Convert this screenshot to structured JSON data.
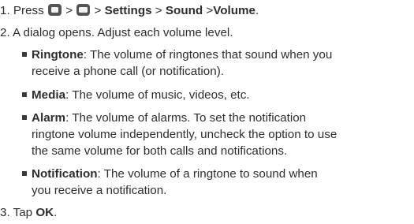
{
  "steps": {
    "s1": {
      "num": "1. Press",
      "sep1": ">",
      "sep2": ">",
      "settings": "Settings",
      "sep3": ">",
      "sound": "Sound",
      "sep4": ">",
      "volume": "Volume",
      "end": ".",
      "icon1": "home-key-icon",
      "icon2": "menu-key-icon"
    },
    "s2": "2. A dialog opens. Adjust each volume level.",
    "s3": {
      "num": "3. Tap",
      "ok": "OK",
      "end": "."
    }
  },
  "bullets": [
    {
      "term": "Ringtone",
      "lines": [
        ": The volume of ringtones that sound when you",
        "receive a phone call (or notification)."
      ]
    },
    {
      "term": "Media",
      "lines": [
        ": The volume of music, videos, etc."
      ]
    },
    {
      "term": "Alarm",
      "lines": [
        ": The volume of alarms. To set the notification",
        "ringtone volume independently, uncheck the option to use",
        "the same volume for both calls and notifications."
      ]
    },
    {
      "term": "Notification",
      "lines": [
        ": The volume of a ringtone to sound when",
        "you receive a notification."
      ]
    }
  ]
}
